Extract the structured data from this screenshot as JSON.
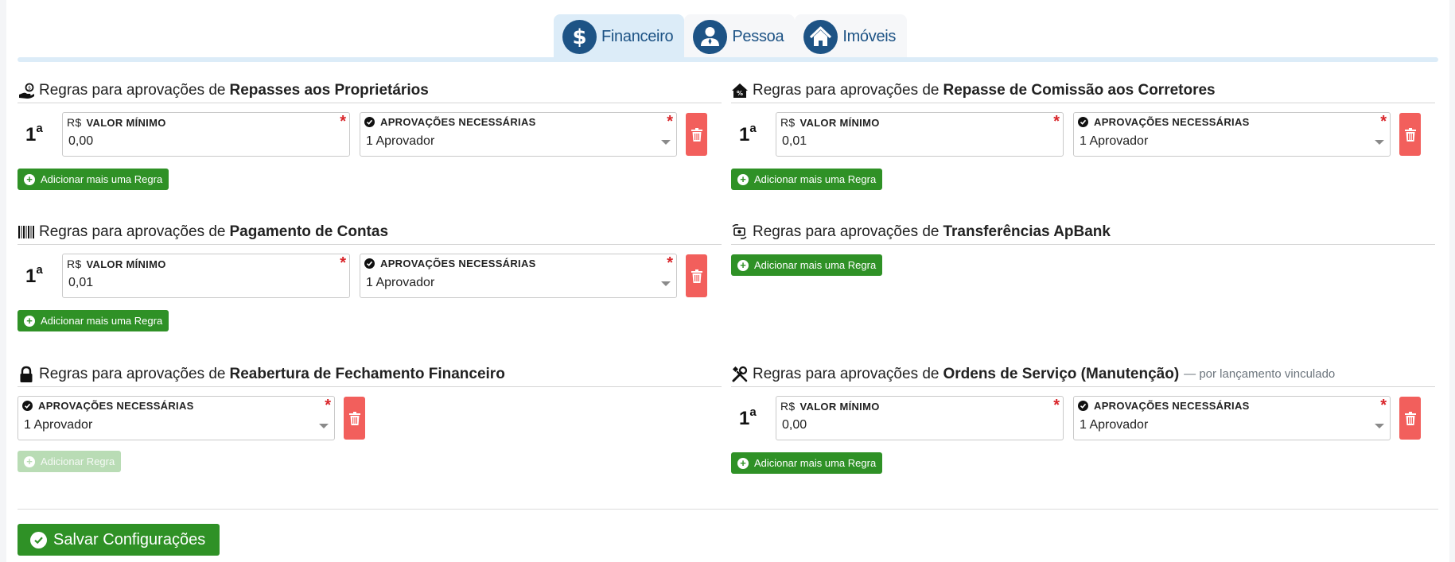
{
  "tabs": [
    {
      "label": "Financeiro",
      "icon": "dollar-icon",
      "active": true
    },
    {
      "label": "Pessoa",
      "icon": "person-icon",
      "active": false
    },
    {
      "label": "Imóveis",
      "icon": "house-icon",
      "active": false
    }
  ],
  "common": {
    "prefix": "Regras para aprovações de",
    "min_value_label": "VALOR MÍNIMO",
    "currency": "R$",
    "approvals_label": "APROVAÇÕES NECESSÁRIAS",
    "required_mark": "*",
    "ordinal_num": "1",
    "ordinal_suffix": "a",
    "add_more_label": "Adicionar mais uma Regra",
    "add_label": "Adicionar Regra"
  },
  "sections": {
    "repasses": {
      "title": "Repasses aos Proprietários",
      "icon": "hand-coin-icon",
      "min_value": "0,00",
      "approvals": "1 Aprovador"
    },
    "comissao": {
      "title": "Repasse de Comissão aos Corretores",
      "icon": "house-percent-icon",
      "min_value": "0,01",
      "approvals": "1 Aprovador"
    },
    "pagamento": {
      "title": "Pagamento de Contas",
      "icon": "barcode-icon",
      "min_value": "0,01",
      "approvals": "1 Aprovador"
    },
    "transferencias": {
      "title": "Transferências ApBank",
      "icon": "money-transfer-icon"
    },
    "reabertura": {
      "title": "Reabertura de Fechamento Financeiro",
      "icon": "lock-icon",
      "approvals": "1 Aprovador"
    },
    "ordens": {
      "title": "Ordens de Serviço (Manutenção)",
      "note": "— por lançamento vinculado",
      "icon": "tools-icon",
      "min_value": "0,00",
      "approvals": "1 Aprovador"
    }
  },
  "save_label": "Salvar Configurações",
  "colors": {
    "primary": "#1d5385",
    "success": "#2f9126",
    "danger": "#f25f5c",
    "tab_active_bg": "#dcecf8"
  }
}
